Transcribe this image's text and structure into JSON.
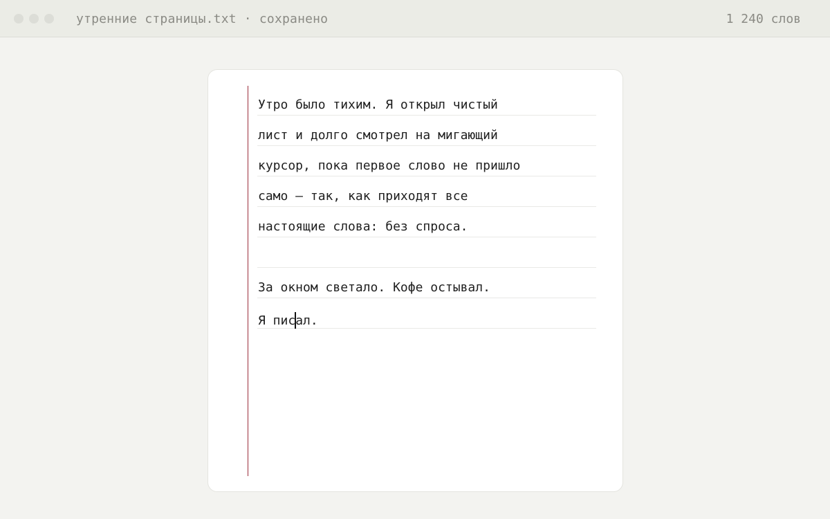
{
  "window": {
    "title": "утренние страницы.txt · сохранено",
    "word_count": "1 240 слов"
  },
  "editor": {
    "lines": [
      "Утро было тихим. Я открыл чистый",
      "лист и долго смотрел на мигающий",
      "курсор, пока первое слово не пришло",
      "само — так, как приходят все",
      "настоящие слова: без спроса.",
      "",
      "За окном светало. Кофе остывал."
    ],
    "current_line_before_caret": "Я пис",
    "current_line_after_caret": "ал."
  },
  "colors": {
    "margin_line": "#9b2c3a",
    "background": "#f3f3f0",
    "page": "#ffffff"
  }
}
